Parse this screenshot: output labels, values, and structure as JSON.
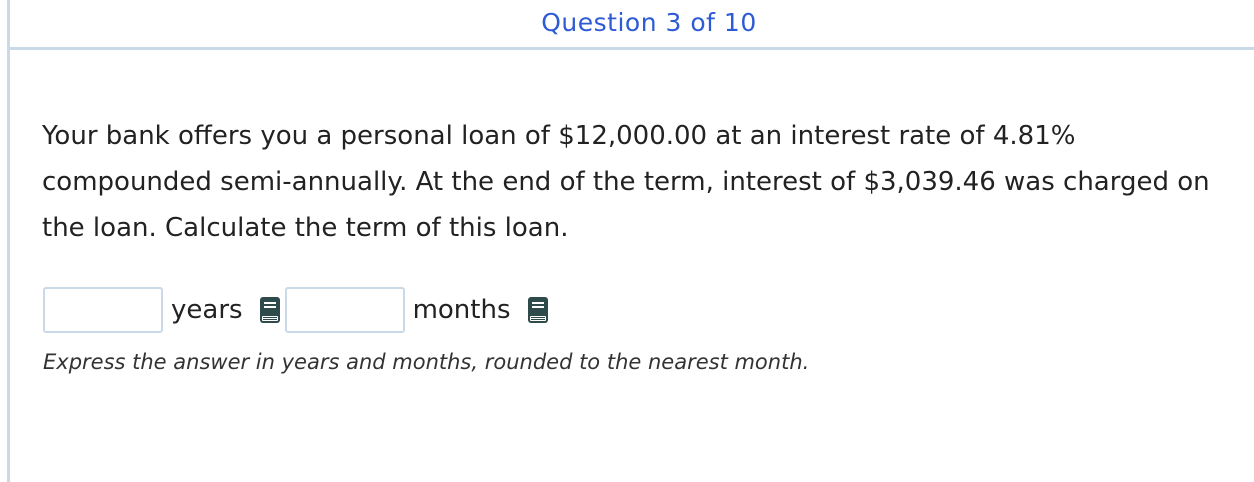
{
  "header": {
    "counter": "Question 3 of 10"
  },
  "question": {
    "prompt": "Your bank offers you a personal loan of $12,000.00 at an interest rate of 4.81% compounded semi-annually. At the end of the term, interest of $3,039.46 was charged on the loan. Calculate the term of this loan."
  },
  "answer": {
    "years_value": "",
    "years_label": "years",
    "months_value": "",
    "months_label": "months",
    "reference_icon": "book-icon"
  },
  "hint": "Express the answer in years and months, rounded to the nearest month.",
  "colors": {
    "accent": "#2d5bd6",
    "rule": "#c9d9e8",
    "icon": "#2f4a4a"
  }
}
